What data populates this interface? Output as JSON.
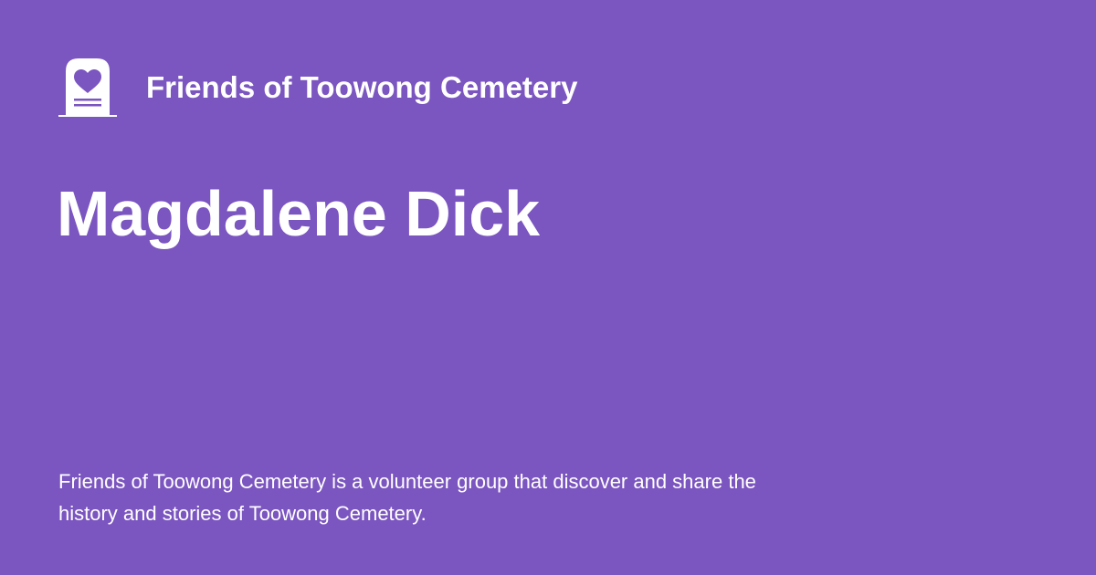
{
  "site": {
    "name": "Friends of Toowong Cemetery",
    "logo_icon": "headstone-heart-icon"
  },
  "page": {
    "title": "Magdalene Dick",
    "description": "Friends of Toowong Cemetery is a volunteer group that discover and share the history and stories of Toowong Cemetery."
  },
  "colors": {
    "background": "#7b55c0",
    "text": "#ffffff"
  }
}
